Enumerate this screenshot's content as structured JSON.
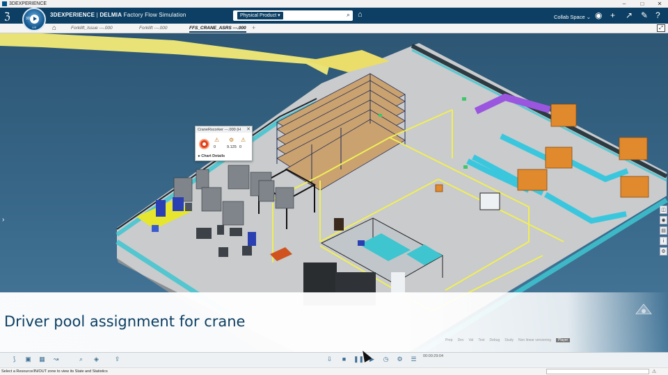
{
  "os_bar": {
    "title": "3DEXPERIENCE",
    "controls": [
      "–",
      "□",
      "✕"
    ]
  },
  "topbar": {
    "brand_prefix": "3DEXPERIENCE",
    "brand_separator": " | ",
    "brand_name": "DELMIA",
    "app_name": " Factory Flow Simulation",
    "compass_label": "3D",
    "compass_version": "V.R",
    "search": {
      "scope": "Physical Product ▾",
      "value": "",
      "placeholder": ""
    },
    "collab_space": "Collab Space ⌄",
    "icons": [
      "user-icon",
      "add-icon",
      "share-icon",
      "tools-icon",
      "help-icon"
    ]
  },
  "tabs": [
    {
      "label": "Forklift_Issue ---.000",
      "active": false
    },
    {
      "label": "Forklift ---.000",
      "active": false
    },
    {
      "label": "FFS_CRANE_ASRS ---.000",
      "active": true
    }
  ],
  "panel": {
    "title": "CraneRscorker ---.000 (H",
    "values": [
      "0",
      "9.125",
      "0"
    ],
    "details": "▸ Chart Details"
  },
  "caption": {
    "text": "Driver pool assignment for crane",
    "phases": [
      "Prep",
      "Dev",
      "Val",
      "Test",
      "Debug",
      "Study",
      "Non linear versioning",
      "Player"
    ],
    "selected_phase": "Player"
  },
  "toolbar": {
    "timecode": "00:00:29:04"
  },
  "status": {
    "text": "Select a Resource/IN/OUT zone to view its State and Statistics"
  },
  "colors": {
    "topbar": "#0c3f63",
    "accent": "#005386",
    "viewport": "#2e5a7c",
    "floor": "#c9cbcd",
    "fence": "#43c4cf"
  }
}
